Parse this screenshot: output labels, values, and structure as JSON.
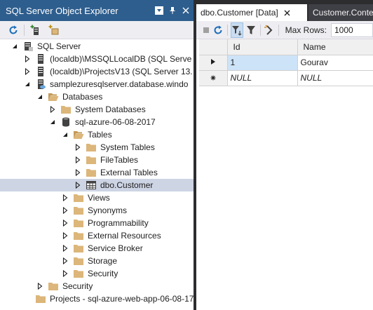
{
  "object_explorer": {
    "title": "SQL Server Object Explorer",
    "tree": [
      {
        "label": "SQL Server",
        "indent": 0,
        "expander": "expanded",
        "icon": "sql-server-icon"
      },
      {
        "label": "(localdb)\\MSSQLLocalDB (SQL Serve",
        "indent": 1,
        "expander": "collapsed",
        "icon": "server-icon"
      },
      {
        "label": "(localdb)\\ProjectsV13 (SQL Server 13.",
        "indent": 1,
        "expander": "collapsed",
        "icon": "server-icon"
      },
      {
        "label": "samplezuresqlserver.database.windo",
        "indent": 1,
        "expander": "expanded",
        "icon": "azure-server-icon"
      },
      {
        "label": "Databases",
        "indent": 2,
        "expander": "expanded",
        "icon": "folder-open-icon"
      },
      {
        "label": "System Databases",
        "indent": 3,
        "expander": "collapsed",
        "icon": "folder-icon"
      },
      {
        "label": "sql-azure-06-08-2017",
        "indent": 3,
        "expander": "expanded",
        "icon": "database-icon"
      },
      {
        "label": "Tables",
        "indent": 4,
        "expander": "expanded",
        "icon": "folder-open-icon"
      },
      {
        "label": "System Tables",
        "indent": 5,
        "expander": "collapsed",
        "icon": "folder-icon"
      },
      {
        "label": "FileTables",
        "indent": 5,
        "expander": "collapsed",
        "icon": "folder-icon"
      },
      {
        "label": "External Tables",
        "indent": 5,
        "expander": "collapsed",
        "icon": "folder-icon"
      },
      {
        "label": "dbo.Customer",
        "indent": 5,
        "expander": "collapsed",
        "icon": "table-icon",
        "selected": true
      },
      {
        "label": "Views",
        "indent": 4,
        "expander": "collapsed",
        "icon": "folder-icon"
      },
      {
        "label": "Synonyms",
        "indent": 4,
        "expander": "collapsed",
        "icon": "folder-icon"
      },
      {
        "label": "Programmability",
        "indent": 4,
        "expander": "collapsed",
        "icon": "folder-icon"
      },
      {
        "label": "External Resources",
        "indent": 4,
        "expander": "collapsed",
        "icon": "folder-icon"
      },
      {
        "label": "Service Broker",
        "indent": 4,
        "expander": "collapsed",
        "icon": "folder-icon"
      },
      {
        "label": "Storage",
        "indent": 4,
        "expander": "collapsed",
        "icon": "folder-icon"
      },
      {
        "label": "Security",
        "indent": 4,
        "expander": "collapsed",
        "icon": "folder-icon"
      },
      {
        "label": "Security",
        "indent": 2,
        "expander": "collapsed",
        "icon": "folder-icon"
      },
      {
        "label": "Projects - sql-azure-web-app-06-08-17",
        "indent": 1,
        "expander": "none",
        "icon": "folder-icon"
      }
    ]
  },
  "document": {
    "tabs": [
      {
        "label": "dbo.Customer [Data]",
        "active": true
      },
      {
        "label": "Customer.Conte",
        "active": false
      }
    ],
    "toolbar": {
      "max_rows_label": "Max Rows:",
      "max_rows_value": "1000"
    },
    "grid": {
      "columns": [
        "Id",
        "Name"
      ],
      "rows": [
        {
          "marker": "current-row-icon",
          "cells": [
            "1",
            "Gourav"
          ]
        },
        {
          "marker": "new-row-icon",
          "cells": [
            "NULL",
            "NULL"
          ]
        }
      ]
    }
  },
  "colors": {
    "title_bar": "#2e5e8e",
    "tree_selection": "#cdd4e4",
    "cell_selection": "#cde3f7",
    "folder": "#dcb67a"
  }
}
